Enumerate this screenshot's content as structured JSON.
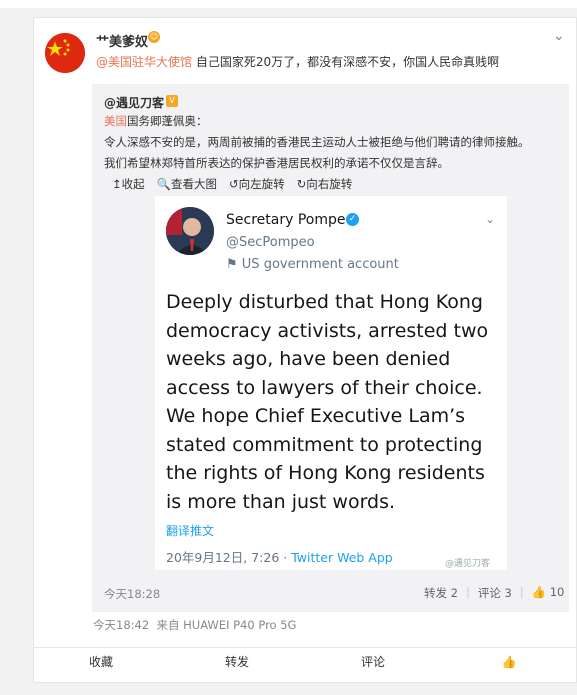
{
  "post": {
    "username": "艹美爹奴",
    "mention": "@美国驻华大使馆",
    "text": " 自己国家死20万了，都没有深感不安，你国人民命真贱啊",
    "time": "今天18:42",
    "source": "来自 HUAWEI P40 Pro 5G"
  },
  "quoted": {
    "username": "@遇见刀客",
    "line1_link": "美国",
    "line1_rest": "国务卿蓬佩奥：",
    "line2": "令人深感不安的是，两周前被捕的香港民主运动人士被拒绝与他们聘请的律师接触。",
    "line3": "我们希望林郑特首所表达的保护香港居民权利的承诺不仅仅是言辞。",
    "actions": [
      "↥收起",
      "🔍查看大图",
      "↺向左旋转",
      "↻向右旋转"
    ],
    "time": "今天18:28",
    "repost": "转发 2",
    "comment": "评论 3",
    "likes": "10"
  },
  "tweet": {
    "name": "Secretary Pompeo",
    "handle": "@SecPompeo",
    "gov_label": "US government account",
    "body": "Deeply disturbed that Hong Kong\ndemocracy activists, arrested two\nweeks ago, have been denied\naccess to lawyers of their choice.\nWe hope Chief Executive Lam’s\nstated commitment to protecting\nthe rights of Hong Kong residents\nis more than just words.",
    "translate": "翻译推文",
    "date": "20年9月12日, 7:26 · ",
    "client": "Twitter Web App",
    "watermark": "@遇见刀客"
  },
  "footer": {
    "favorite": "收藏",
    "repost": "转发",
    "comment": "评论"
  },
  "colors": {
    "link": "#eb7350",
    "twitter_blue": "#1da1f2"
  }
}
